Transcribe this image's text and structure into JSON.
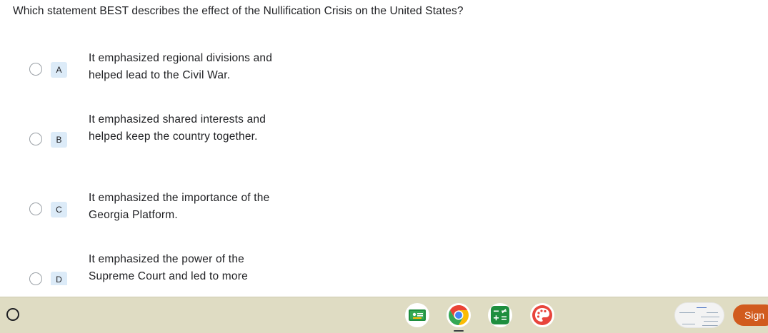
{
  "question": "Which statement BEST describes the effect of the Nullification Crisis on the United States?",
  "options": [
    {
      "letter": "A",
      "text": "It emphasized regional divisions and helped lead to the Civil War."
    },
    {
      "letter": "B",
      "text": "It emphasized shared interests and helped keep the country together."
    },
    {
      "letter": "C",
      "text": "It emphasized the importance of the Georgia Platform."
    },
    {
      "letter": "D",
      "text": "It emphasized the power of the Supreme Court and led to more"
    }
  ],
  "shelf": {
    "apps": [
      {
        "name": "google-classroom-icon"
      },
      {
        "name": "chrome-icon"
      },
      {
        "name": "calculator-icon"
      },
      {
        "name": "paint-palette-icon"
      }
    ],
    "sign_button": "Sign",
    "colors": {
      "shelf_bg": "#dfdcc3",
      "sign_button": "#d15b1e",
      "letter_bg": "#dcebf8"
    }
  }
}
